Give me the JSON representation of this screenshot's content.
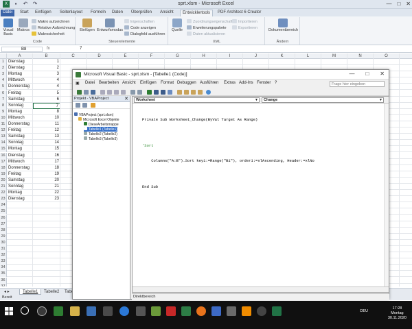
{
  "excel": {
    "title": "sprt.xlsm - Microsoft Excel",
    "qat_icons": [
      "excel-logo-icon",
      "save-icon",
      "undo-icon",
      "redo-icon"
    ],
    "window_controls": [
      "—",
      "□",
      "✕"
    ],
    "tabs": [
      {
        "label": "Datei"
      },
      {
        "label": "Start"
      },
      {
        "label": "Einfügen"
      },
      {
        "label": "Seitenlayout"
      },
      {
        "label": "Formeln"
      },
      {
        "label": "Daten"
      },
      {
        "label": "Überprüfen"
      },
      {
        "label": "Ansicht"
      },
      {
        "label": "Entwicklertools"
      },
      {
        "label": "PDF Architect 6 Creator"
      }
    ],
    "ribbon": {
      "code_group": {
        "label": "Code",
        "visual_basic": "Visual Basic",
        "makros": "Makros",
        "makro_aufzeichnen": "Makro aufzeichnen",
        "relative_aufzeichnung": "Relative Aufzeichnung",
        "makrosicherheit": "Makrosicherheit"
      },
      "controls_group": {
        "label": "Steuerelemente",
        "einfuegen": "Einfügen",
        "entwurfsmodus": "Entwurfsmodus",
        "eigenschaften": "Eigenschaften",
        "code_anzeigen": "Code anzeigen",
        "dialogfeld": "Dialogfeld ausführen"
      },
      "xml_group": {
        "label": "XML",
        "quelle": "Quelle",
        "zuordnungs": "Zuordnungseigenschaften",
        "erweiterungspakete": "Erweiterungspakete",
        "daten_aktualisieren": "Daten aktualisieren",
        "importieren": "Importieren",
        "exportieren": "Exportieren"
      },
      "modify_group": {
        "label": "Ändern",
        "dokumentbereich": "Dokumentbereich"
      }
    },
    "namebox": "B8",
    "fx": "fx",
    "formula_value": "7",
    "columns": [
      "A",
      "B",
      "C",
      "D",
      "E",
      "F",
      "G",
      "H",
      "I",
      "J",
      "K",
      "L",
      "M",
      "N",
      "O"
    ],
    "rows": [
      {
        "n": "1",
        "a": "Dienstag",
        "b": "1"
      },
      {
        "n": "2",
        "a": "Dienstag",
        "b": "2"
      },
      {
        "n": "3",
        "a": "Montag",
        "b": "3"
      },
      {
        "n": "4",
        "a": "Mittwoch",
        "b": "4"
      },
      {
        "n": "5",
        "a": "Donnerstag",
        "b": "4"
      },
      {
        "n": "6",
        "a": "Freitag",
        "b": "5"
      },
      {
        "n": "7",
        "a": "Samstag",
        "b": "6"
      },
      {
        "n": "8",
        "a": "Sonntag",
        "b": "7"
      },
      {
        "n": "9",
        "a": "Montag",
        "b": "8"
      },
      {
        "n": "10",
        "a": "Mittwoch",
        "b": "10"
      },
      {
        "n": "11",
        "a": "Donnerstag",
        "b": "11"
      },
      {
        "n": "12",
        "a": "Freitag",
        "b": "12"
      },
      {
        "n": "13",
        "a": "Samstag",
        "b": "13"
      },
      {
        "n": "14",
        "a": "Sonntag",
        "b": "14"
      },
      {
        "n": "15",
        "a": "Montag",
        "b": "15"
      },
      {
        "n": "16",
        "a": "Dienstag",
        "b": "16"
      },
      {
        "n": "17",
        "a": "Mittwoch",
        "b": "17"
      },
      {
        "n": "18",
        "a": "Donnerstag",
        "b": "18"
      },
      {
        "n": "19",
        "a": "Freitag",
        "b": "19"
      },
      {
        "n": "20",
        "a": "Samstag",
        "b": "20"
      },
      {
        "n": "21",
        "a": "Sonntag",
        "b": "21"
      },
      {
        "n": "22",
        "a": "Montag",
        "b": "22"
      },
      {
        "n": "23",
        "a": "Dienstag",
        "b": "23"
      },
      {
        "n": "24",
        "a": "",
        "b": ""
      },
      {
        "n": "25",
        "a": "",
        "b": ""
      },
      {
        "n": "26",
        "a": "",
        "b": ""
      },
      {
        "n": "27",
        "a": "",
        "b": ""
      },
      {
        "n": "28",
        "a": "",
        "b": ""
      },
      {
        "n": "29",
        "a": "",
        "b": ""
      },
      {
        "n": "30",
        "a": "",
        "b": ""
      },
      {
        "n": "31",
        "a": "",
        "b": ""
      },
      {
        "n": "32",
        "a": "",
        "b": ""
      },
      {
        "n": "33",
        "a": "",
        "b": ""
      },
      {
        "n": "34",
        "a": "",
        "b": ""
      },
      {
        "n": "35",
        "a": "",
        "b": ""
      },
      {
        "n": "36",
        "a": "",
        "b": ""
      },
      {
        "n": "37",
        "a": "",
        "b": ""
      }
    ],
    "selected_row": "8",
    "sheet_tabs": [
      "Tabelle1",
      "Tabelle2",
      "Tabe"
    ],
    "status": "Bereit"
  },
  "vba": {
    "title": "Microsoft Visual Basic - sprt.xlsm - [Tabelle1 (Code)]",
    "window_controls": [
      "—",
      "□",
      "✕"
    ],
    "menu": [
      "Datei",
      "Bearbeiten",
      "Ansicht",
      "Einfügen",
      "Format",
      "Debuggen",
      "Ausführen",
      "Extras",
      "Add-Ins",
      "Fenster",
      "?"
    ],
    "search_placeholder": "Frage hier eingeben",
    "project_title": "Projekt - VBAProject",
    "project_close": "✕",
    "tree": [
      "VBAProject (sprt.xlsm)",
      "Microsoft Excel Objekte",
      "DieseArbeitsmappe",
      "Tabelle1 (Tabelle1)",
      "Tabelle2 (Tabelle2)",
      "Tabelle3 (Tabelle3)"
    ],
    "object_combo": "Worksheet",
    "proc_combo": "Change",
    "code_lines": [
      "Private Sub Worksheet_Change(ByVal Target As Range)",
      "",
      "'Sort",
      "    Columns(\"A:B\").Sort key1:=Range(\"B1\"), order1:=xlAscending, Header:=xlNo",
      "",
      "End Sub"
    ],
    "immediate_label": "Direktbereich"
  },
  "taskbar": {
    "lang": "DEU",
    "time": "17:28",
    "day": "Montag",
    "date": "30.11.2020"
  }
}
